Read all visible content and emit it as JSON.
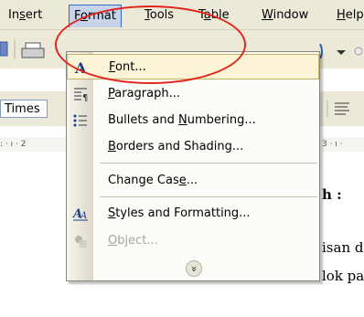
{
  "menubar": {
    "items": [
      {
        "pre": "In",
        "acc": "s",
        "post": "ert"
      },
      {
        "pre": "F",
        "acc": "o",
        "post": "rmat"
      },
      {
        "pre": "",
        "acc": "T",
        "post": "ools"
      },
      {
        "pre": "T",
        "acc": "a",
        "post": "ble"
      },
      {
        "pre": "",
        "acc": "W",
        "post": "indow"
      },
      {
        "pre": "",
        "acc": "H",
        "post": "elp"
      }
    ]
  },
  "toolbar": {
    "font_name": "Times",
    "ruler_left": ": · ı · 2",
    "ruler_right": "3 · ı ·"
  },
  "document": {
    "line1": "h :",
    "line2": "isan d",
    "line3": "lok pa"
  },
  "format_menu": {
    "items": [
      {
        "pre": "",
        "acc": "F",
        "post": "ont...",
        "icon": "font-a-icon",
        "highlighted": true
      },
      {
        "pre": "",
        "acc": "P",
        "post": "aragraph...",
        "icon": "paragraph-icon"
      },
      {
        "pre": "Bullets and ",
        "acc": "N",
        "post": "umbering...",
        "icon": "bullets-icon"
      },
      {
        "pre": "",
        "acc": "B",
        "post": "orders and Shading...",
        "icon": ""
      },
      {
        "pre": "Change Cas",
        "acc": "e",
        "post": "...",
        "icon": ""
      },
      {
        "pre": "",
        "acc": "S",
        "post": "tyles and Formatting...",
        "icon": "styles-icon"
      },
      {
        "pre": "",
        "acc": "O",
        "post": "bject...",
        "icon": "object-icon",
        "disabled": true
      }
    ],
    "expand_glyph": "»"
  },
  "colors": {
    "highlight_fill": "#fbf4d6",
    "highlight_border": "#c9b25e",
    "annotation_ellipse": "#e2231a"
  }
}
